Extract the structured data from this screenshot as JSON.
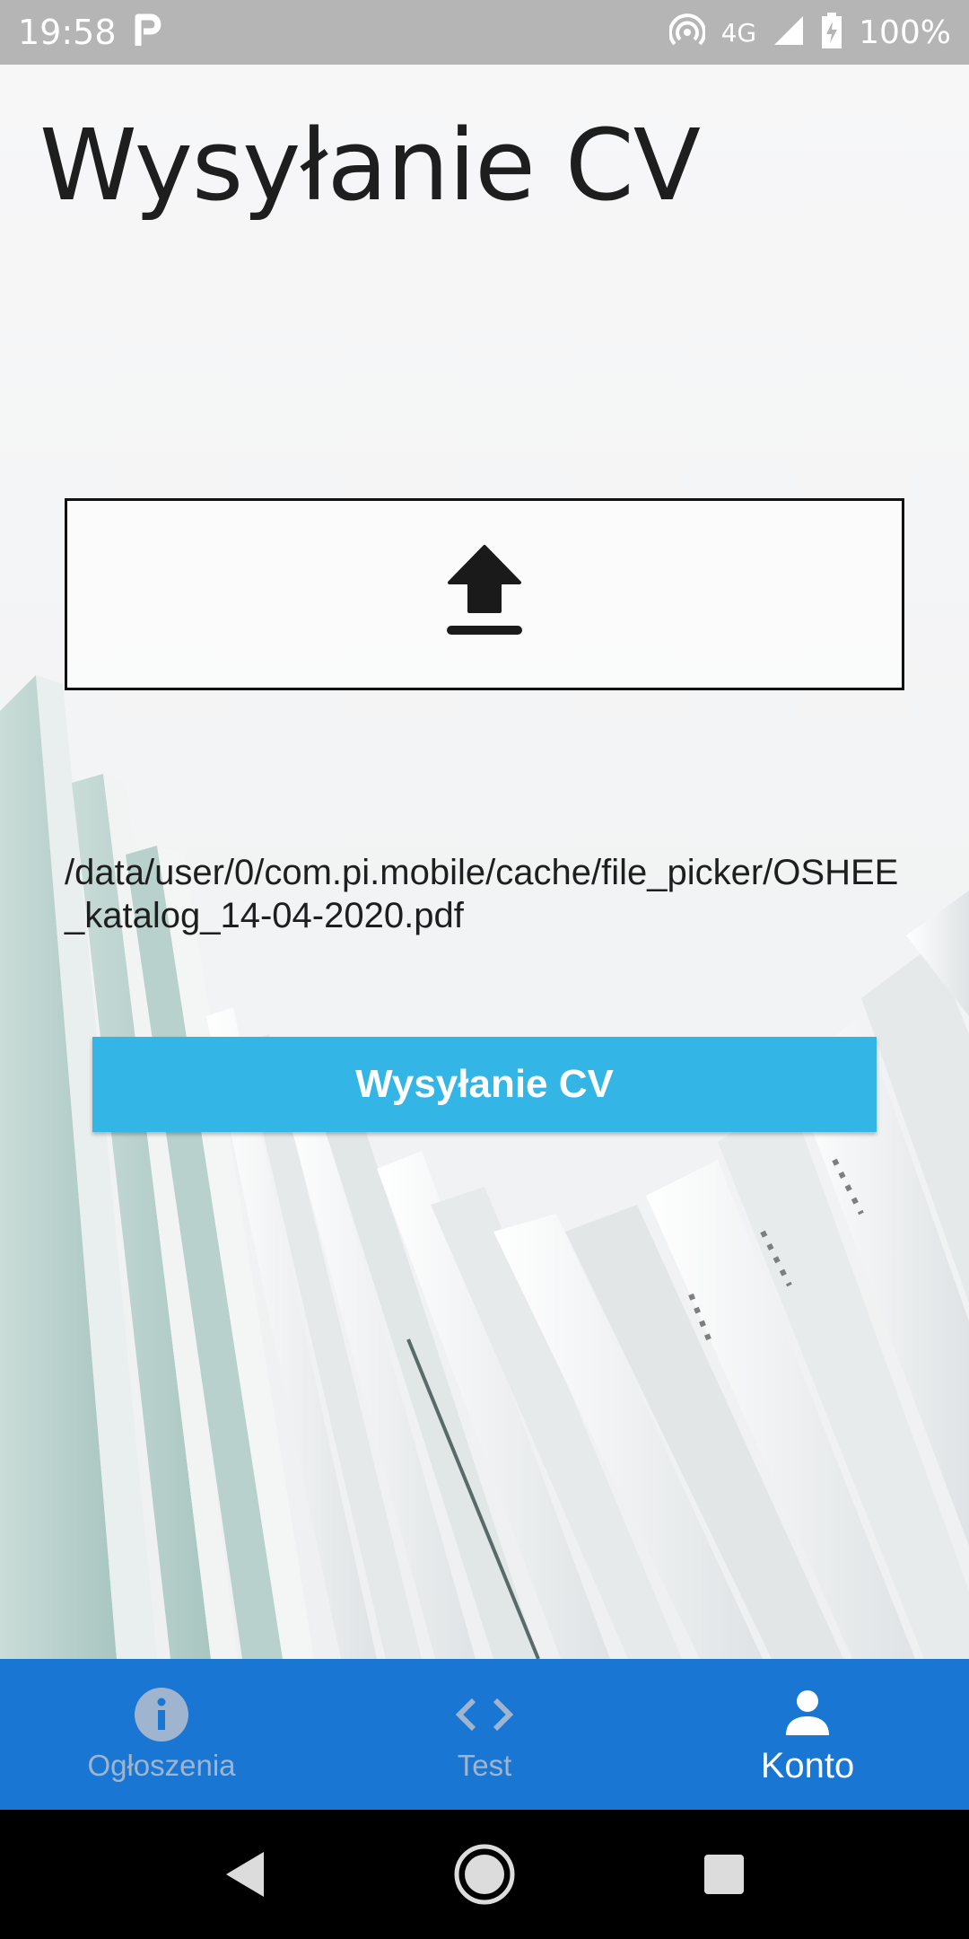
{
  "status_bar": {
    "time": "19:58",
    "app_notification_icon": "p-icon",
    "network": "4G",
    "battery": "100%"
  },
  "page": {
    "title": "Wysyłanie CV"
  },
  "upload": {
    "icon": "upload-icon"
  },
  "file": {
    "path": "/data/user/0/com.pi.mobile/cache/file_picker/OSHEE_katalog_14-04-2020.pdf"
  },
  "send_button": {
    "label": "Wysyłanie CV"
  },
  "bottom_nav": {
    "items": [
      {
        "label": "Ogłoszenia",
        "icon": "info-icon",
        "active": false
      },
      {
        "label": "Test",
        "icon": "code-icon",
        "active": false
      },
      {
        "label": "Konto",
        "icon": "person-icon",
        "active": true
      }
    ]
  },
  "colors": {
    "accent_button": "#33b5e6",
    "nav_background": "#1976d2",
    "status_bar": "#b5b5b5"
  }
}
